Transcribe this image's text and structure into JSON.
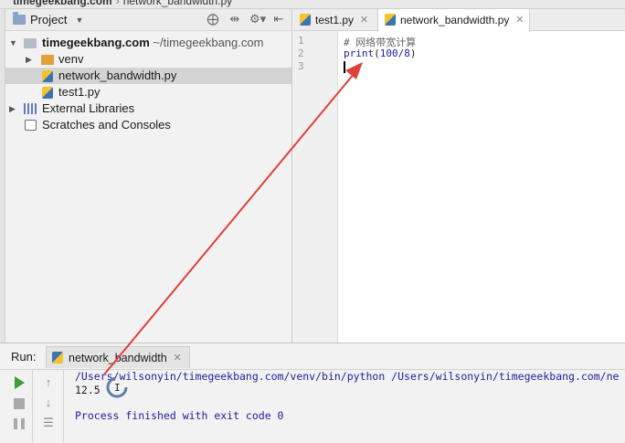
{
  "breadcrumb": {
    "project": "timegeekbang.com",
    "file": "network_bandwidth.py"
  },
  "project_panel": {
    "title": "Project",
    "root": {
      "name": "timegeekbang.com",
      "path": "~/timegeekbang.com"
    },
    "items": [
      {
        "label": "venv"
      },
      {
        "label": "network_bandwidth.py"
      },
      {
        "label": "test1.py"
      },
      {
        "label": "External Libraries"
      },
      {
        "label": "Scratches and Consoles"
      }
    ]
  },
  "editor": {
    "tabs": [
      {
        "label": "test1.py"
      },
      {
        "label": "network_bandwidth.py"
      }
    ],
    "line_numbers": [
      "1",
      "2",
      "3"
    ],
    "lines": {
      "comment": "# 网络带宽计算",
      "print_kw": "print",
      "print_open": "(",
      "print_num": "100/8",
      "print_close": ")"
    }
  },
  "run_panel": {
    "label": "Run:",
    "tab": "network_bandwidth",
    "console": {
      "command": "/Users/wilsonyin/timegeekbang.com/venv/bin/python /Users/wilsonyin/timegeekbang.com/ne",
      "output": "12.5",
      "finished": "Process finished with exit code 0"
    }
  },
  "colors": {
    "arrow": "#e0403a",
    "selection": "#d4d4d4",
    "run_green": "#3f9c3b",
    "console_blue": "#1e1e9e"
  }
}
